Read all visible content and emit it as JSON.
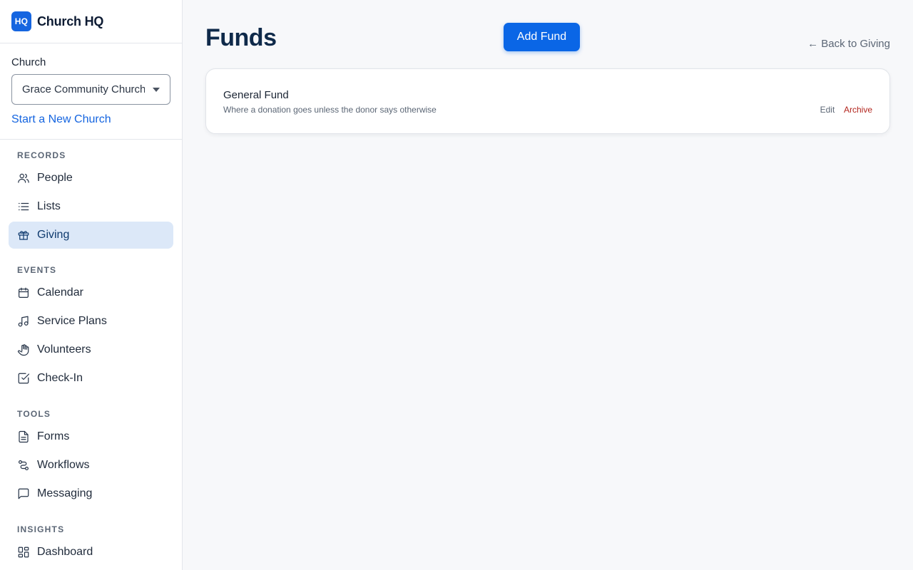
{
  "brand": {
    "logo_text": "HQ",
    "name": "Church HQ"
  },
  "church": {
    "label": "Church",
    "selected": "Grace Community Church",
    "new_link": "Start a New Church"
  },
  "nav": {
    "sections": [
      {
        "title": "RECORDS",
        "items": [
          {
            "label": "People",
            "icon": "people-icon"
          },
          {
            "label": "Lists",
            "icon": "list-icon"
          },
          {
            "label": "Giving",
            "icon": "gift-icon",
            "active": true
          }
        ]
      },
      {
        "title": "EVENTS",
        "items": [
          {
            "label": "Calendar",
            "icon": "calendar-icon"
          },
          {
            "label": "Service Plans",
            "icon": "music-note-icon"
          },
          {
            "label": "Volunteers",
            "icon": "hand-icon"
          },
          {
            "label": "Check-In",
            "icon": "check-square-icon"
          }
        ]
      },
      {
        "title": "TOOLS",
        "items": [
          {
            "label": "Forms",
            "icon": "document-icon"
          },
          {
            "label": "Workflows",
            "icon": "workflow-icon"
          },
          {
            "label": "Messaging",
            "icon": "message-icon"
          }
        ]
      },
      {
        "title": "INSIGHTS",
        "items": [
          {
            "label": "Dashboard",
            "icon": "dashboard-icon"
          }
        ]
      }
    ]
  },
  "main": {
    "title": "Funds",
    "add_button": "Add Fund",
    "back_link": "← Back to Giving",
    "funds": [
      {
        "name": "General Fund",
        "description": "Where a donation goes unless the donor says otherwise",
        "edit_label": "Edit",
        "archive_label": "Archive"
      }
    ]
  },
  "colors": {
    "accent": "#0a66e6",
    "active_nav_bg": "#dce8f8",
    "danger": "#b3261e"
  }
}
